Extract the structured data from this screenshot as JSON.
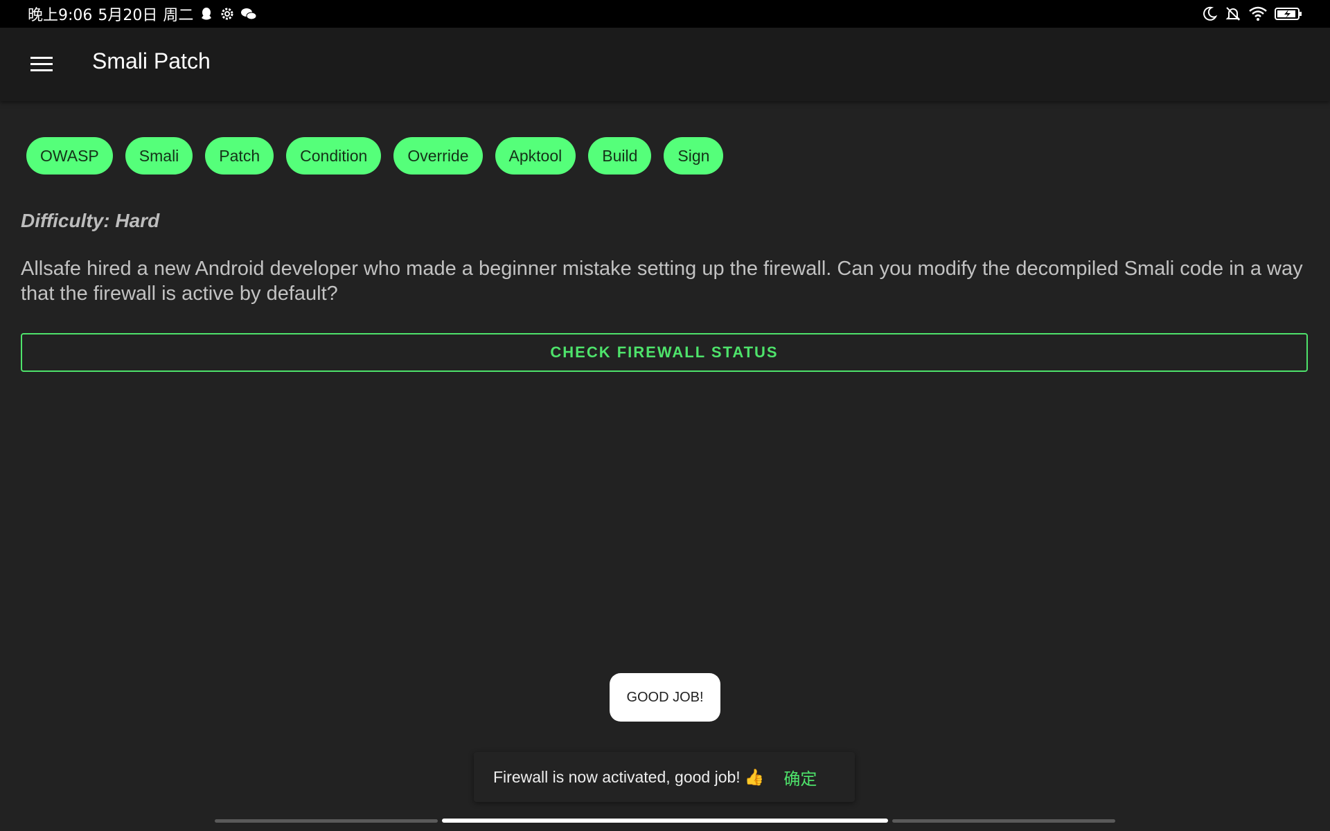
{
  "status_bar": {
    "time": "晚上9:06",
    "date": "5月20日",
    "weekday": "周二",
    "left_icons": [
      "qq-icon",
      "settings-gear-icon",
      "wechat-icon"
    ],
    "right_icons": [
      "moon-icon",
      "bell-off-icon",
      "wifi-icon",
      "battery-icon"
    ]
  },
  "app_bar": {
    "title": "Smali Patch",
    "menu_icon": "hamburger-menu-icon"
  },
  "tags": [
    "OWASP",
    "Smali",
    "Patch",
    "Condition",
    "Override",
    "Apktool",
    "Build",
    "Sign"
  ],
  "content": {
    "difficulty": "Difficulty: Hard",
    "description": "Allsafe hired a new Android developer who made a beginner mistake setting up the firewall. Can you modify the decompiled Smali code in a way that the firewall is active by default?",
    "button_label": "CHECK FIREWALL STATUS"
  },
  "toast": {
    "text": "GOOD JOB!"
  },
  "snackbar": {
    "message": "Firewall is now activated, good job!",
    "emoji": "👍",
    "action": "确定"
  },
  "colors": {
    "background": "#222222",
    "app_bar": "#1b1b1b",
    "accent_green": "#4ee36b",
    "chip_green": "#55ff7a"
  }
}
